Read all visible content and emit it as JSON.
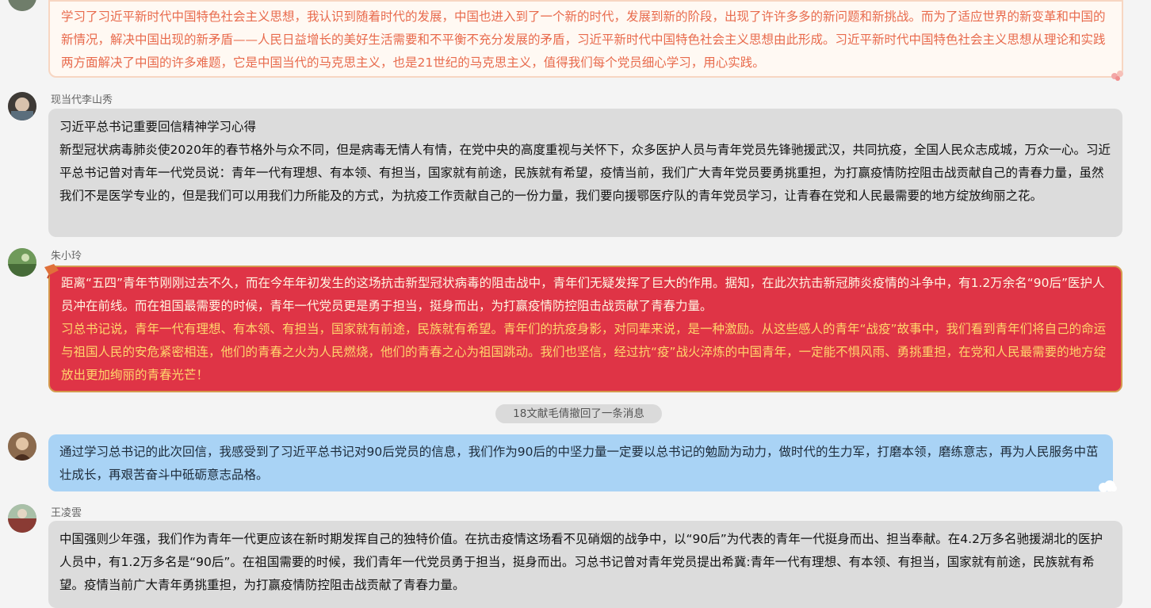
{
  "messages": [
    {
      "sender": "",
      "paragraphs": [
        "学习了习近平新时代中国特色社会主义思想，我认识到随着时代的发展，中国也进入到了一个新的时代，发展到新的阶段，出现了许许多多的新问题和新挑战。而为了适应世界的新变革和中国的新情况，解决中国出现的新矛盾——人民日益增长的美好生活需要和不平衡不充分发展的矛盾，习近平新时代中国特色社会主义思想由此形成。习近平新时代中国特色社会主义思想从理论和实践两方面解决了中国的许多难题，它是中国当代的马克思主义，也是21世纪的马克思主义，值得我们每个党员细心学习，用心实践。"
      ]
    },
    {
      "sender": "现当代李山秀",
      "paragraphs": [
        "习近平总书记重要回信精神学习心得",
        "新型冠状病毒肺炎使2020年的春节格外与众不同，但是病毒无情人有情，在党中央的高度重视与关怀下，众多医护人员与青年党员先锋驰援武汉，共同抗疫，全国人民众志成城，万众一心。习近平总书记曾对青年一代党员说：青年一代有理想、有本领、有担当，国家就有前途，民族就有希望，疫情当前，我们广大青年党员要勇挑重担，为打赢疫情防控阻击战贡献自己的青春力量，虽然我们不是医学专业的，但是我们可以用我们力所能及的方式，为抗疫工作贡献自己的一份力量，我们要向援鄂医疗队的青年党员学习，让青春在党和人民最需要的地方绽放绚丽之花。"
      ]
    },
    {
      "sender": "朱小玲",
      "paragraphs": [
        "距离“五四”青年节刚刚过去不久，而在今年年初发生的这场抗击新型冠状病毒的阻击战中，青年们无疑发挥了巨大的作用。据知，在此次抗击新冠肺炎疫情的斗争中，有1.2万余名“90后”医护人员冲在前线。而在祖国最需要的时候，青年一代党员更是勇于担当，挺身而出，为打赢疫情防控阻击战贡献了青春力量。",
        "习总书记说，青年一代有理想、有本领、有担当，国家就有前途，民族就有希望。青年们的抗疫身影，对同辈来说，是一种激励。从这些感人的青年“战疫”故事中，我们看到青年们将自己的命运与祖国人民的安危紧密相连，他们的青春之火为人民燃烧，他们的青春之心为祖国跳动。我们也坚信，经过抗“疫”战火淬炼的中国青年，一定能不惧风雨、勇挑重担，在党和人民最需要的地方绽放出更加绚丽的青春光芒！"
      ]
    },
    {
      "sender": "",
      "paragraphs": [
        "通过学习总书记的此次回信，我感受到了习近平总书记对90后党员的信息，我们作为90后的中坚力量一定要以总书记的勉励为动力，做时代的生力军，打磨本领，磨练意志，再为人民服务中茁壮成长，再艰苦奋斗中砥砺意志品格。"
      ]
    },
    {
      "sender": "王凌雲",
      "paragraphs": [
        "中国强则少年强，我们作为青年一代更应该在新时期发挥自己的独特价值。在抗击疫情这场看不见硝烟的战争中，以“90后”为代表的青年一代挺身而出、担当奉献。在4.2万多名驰援湖北的医护人员中，有1.2万多名是“90后”。在祖国需要的时候，我们青年一代党员勇于担当，挺身而出。习总书记曾对青年党员提出希冀:青年一代有理想、有本领、有担当，国家就有前途，民族就有希望。疫情当前广大青年勇挑重担，为打赢疫情防控阻击战贡献了青春力量。"
      ]
    }
  ],
  "system_notice": "18文献毛倩撤回了一条消息",
  "colors": {
    "red_bubble": "#df3446",
    "blue_bubble": "#a9d3f5",
    "gray_bubble": "#dcdcdc",
    "orange_text": "#e86a4c"
  }
}
